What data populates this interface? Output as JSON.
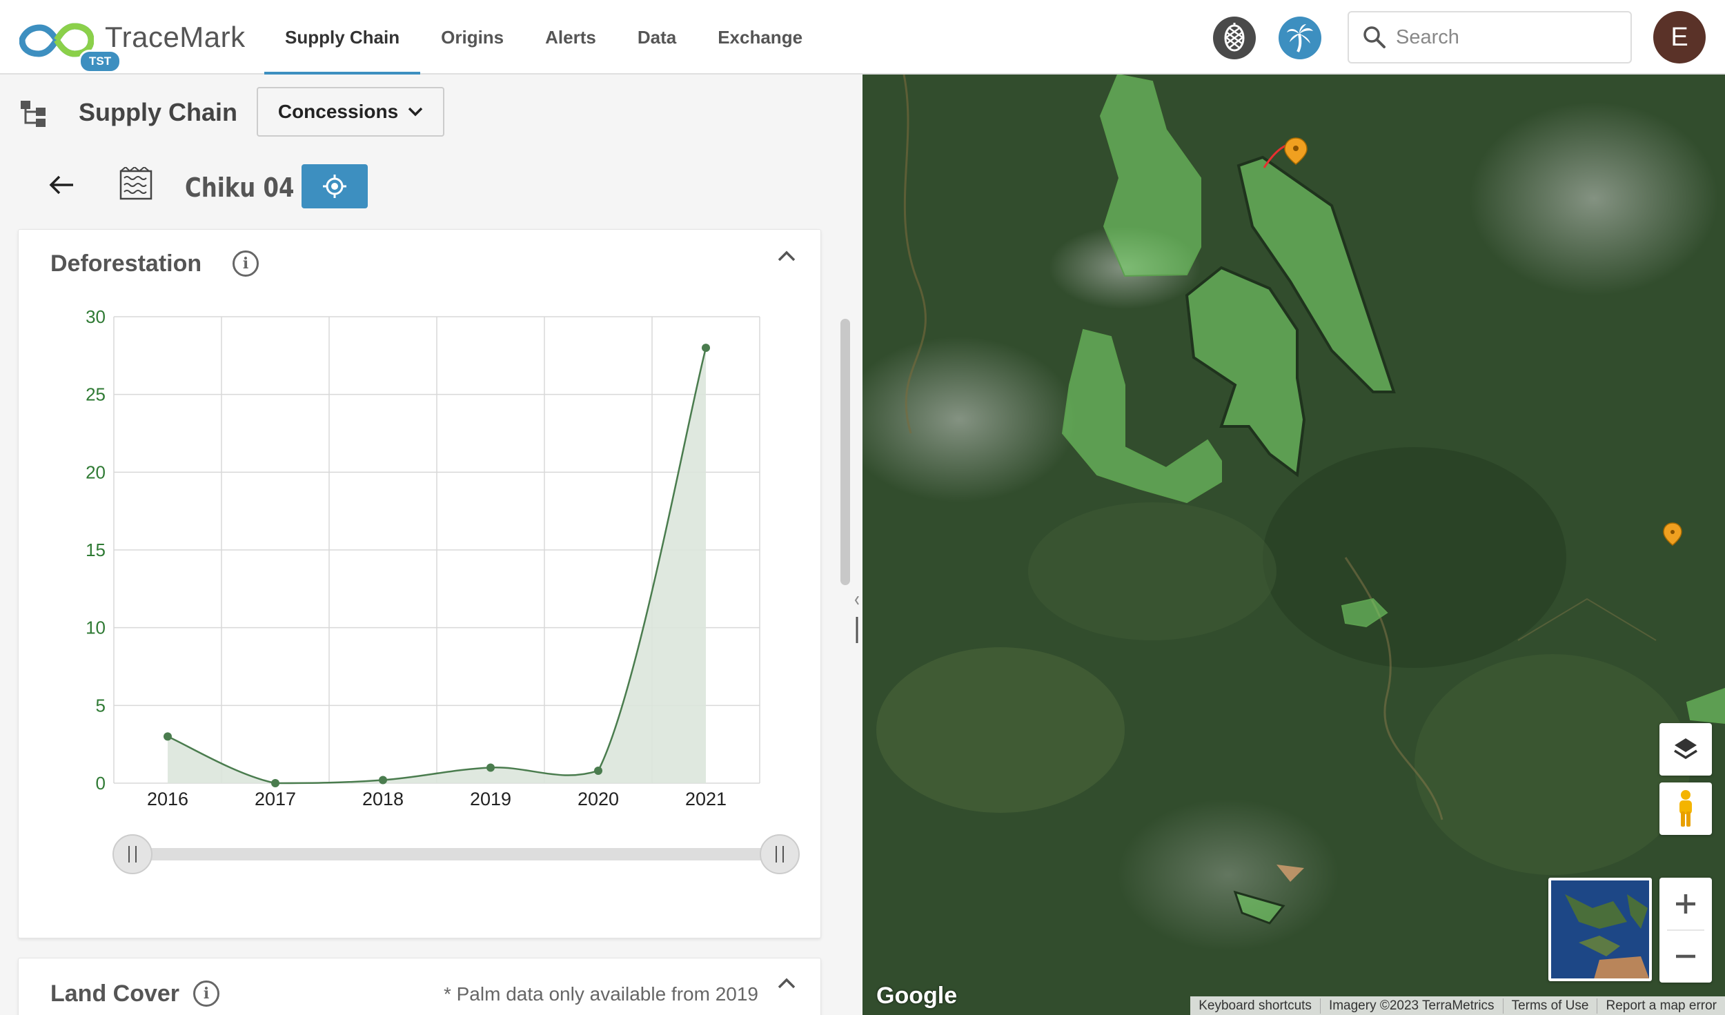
{
  "app": {
    "name": "TraceMark",
    "badge": "TST"
  },
  "nav": {
    "tabs": [
      "Supply Chain",
      "Origins",
      "Alerts",
      "Data",
      "Exchange"
    ],
    "active": "Supply Chain"
  },
  "header": {
    "commodity_buttons": [
      {
        "icon": "pinecone-icon"
      },
      {
        "icon": "palm-tree-icon"
      }
    ],
    "search": {
      "placeholder": "Search",
      "value": ""
    },
    "avatar_initial": "E"
  },
  "panel": {
    "title": "Supply Chain",
    "dropdown": {
      "value": "Concessions"
    },
    "entity": {
      "name": "Chiku 04"
    }
  },
  "deforestation": {
    "title": "Deforestation",
    "range_start": "2016",
    "range_end": "2021"
  },
  "land_cover": {
    "title": "Land Cover",
    "note": "* Palm data only available from 2019"
  },
  "chart_data": {
    "type": "area",
    "categories": [
      "2016",
      "2017",
      "2018",
      "2019",
      "2020",
      "2021"
    ],
    "values": [
      3.0,
      0.0,
      0.2,
      1.0,
      0.8,
      28.0
    ],
    "ylim": [
      0,
      30
    ],
    "yticks": [
      0,
      5,
      10,
      15,
      20,
      25,
      30
    ],
    "title": "",
    "xlabel": "",
    "ylabel": "",
    "grid": true,
    "colors": {
      "line": "#4a7c4e",
      "fill": "#dbe5dc",
      "ticks": "#2f7a34"
    }
  },
  "map": {
    "provider": "Google",
    "attribution": [
      "Keyboard shortcuts",
      "Imagery ©2023 TerraMetrics",
      "Terms of Use",
      "Report a map error"
    ]
  },
  "colors": {
    "accent": "#3d8fc0",
    "concession_fill": "#7ad66b",
    "marker": "#f0a020"
  }
}
